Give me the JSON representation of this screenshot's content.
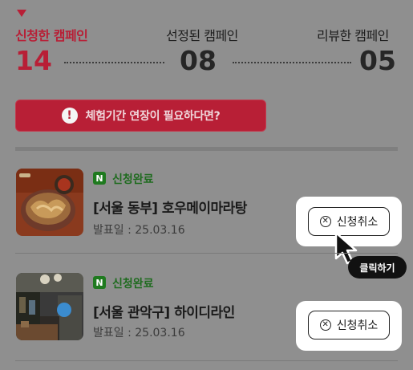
{
  "stats": {
    "applied": {
      "label": "신청한 캠페인",
      "count": "14"
    },
    "selected": {
      "label": "선정된 캠페인",
      "count": "08"
    },
    "reviewed": {
      "label": "리뷰한 캠페인",
      "count": "05"
    }
  },
  "alert": {
    "icon": "exclamation-icon",
    "text": "체험기간 연장이 필요하다면?"
  },
  "campaigns": [
    {
      "badge": "N",
      "status": "신청완료",
      "title": "[서울 동부] 호우메이마라탕",
      "pub_date": "발표일 : 25.03.16",
      "cancel_label": "신청취소"
    },
    {
      "badge": "N",
      "status": "신청완료",
      "title": "[서울 관악구] 하이디라인",
      "pub_date": "발표일 : 25.03.16",
      "cancel_label": "신청취소"
    }
  ],
  "tooltip": {
    "text": "클릭하기"
  },
  "colors": {
    "accent": "#b81f36",
    "overlay_bg": "#8f8f8f",
    "status_green": "#1f6b1f",
    "tooltip_bg": "#111111"
  }
}
